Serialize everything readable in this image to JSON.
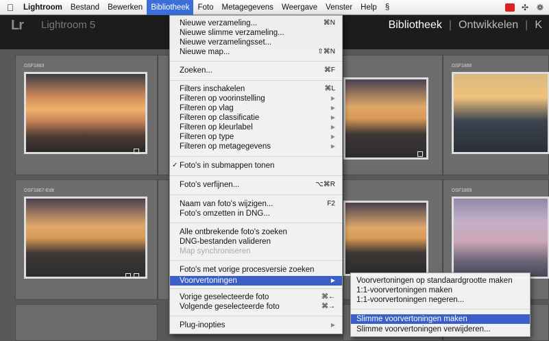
{
  "menubar": {
    "apple": "",
    "app": "Lightroom",
    "items": [
      "Bestand",
      "Bewerken",
      "Bibliotheek",
      "Foto",
      "Metagegevens",
      "Weergave",
      "Venster",
      "Help"
    ],
    "active": "Bibliotheek"
  },
  "header": {
    "logo": "Lr",
    "app_name": "Lightroom 5",
    "modules": [
      "Bibliotheek",
      "Ontwikkelen",
      "K"
    ]
  },
  "grid": {
    "cells": [
      {
        "number": "",
        "filename": "DSF1863"
      },
      {
        "number": "",
        "filename": ""
      },
      {
        "number": "",
        "filename": "DSF1866"
      },
      {
        "number": "",
        "filename": "DSF1867-Edit"
      },
      {
        "number": "",
        "filename": ""
      },
      {
        "number": "",
        "filename": "DSF1869"
      }
    ]
  },
  "menu": {
    "items": [
      {
        "label": "Nieuwe verzameling...",
        "shortcut": "⌘N"
      },
      {
        "label": "Nieuwe slimme verzameling..."
      },
      {
        "label": "Nieuwe verzamelingsset..."
      },
      {
        "label": "Nieuwe map...",
        "shortcut": "⇧⌘N"
      },
      {
        "label": "Zoeken...",
        "shortcut": "⌘F"
      },
      {
        "label": "Filters inschakelen",
        "shortcut": "⌘L"
      },
      {
        "label": "Filteren op voorinstelling",
        "submenu": true
      },
      {
        "label": "Filteren op vlag",
        "submenu": true
      },
      {
        "label": "Filteren op classificatie",
        "submenu": true
      },
      {
        "label": "Filteren op kleurlabel",
        "submenu": true
      },
      {
        "label": "Filteren op type",
        "submenu": true
      },
      {
        "label": "Filteren op metagegevens",
        "submenu": true
      },
      {
        "label": "Foto's in submappen tonen",
        "checked": true
      },
      {
        "label": "Foto's verfijnen...",
        "shortcut": "⌥⌘R"
      },
      {
        "label": "Naam van foto's wijzigen...",
        "shortcut": "F2"
      },
      {
        "label": "Foto's omzetten in DNG..."
      },
      {
        "label": "Alle ontbrekende foto's zoeken"
      },
      {
        "label": "DNG-bestanden valideren"
      },
      {
        "label": "Map synchroniseren",
        "disabled": true
      },
      {
        "label": "Foto's met vorige procesversie zoeken"
      },
      {
        "label": "Voorvertoningen",
        "submenu": true,
        "highlighted": true
      },
      {
        "label": "Vorige geselecteerde foto",
        "shortcut": "⌘←"
      },
      {
        "label": "Volgende geselecteerde foto",
        "shortcut": "⌘→"
      },
      {
        "label": "Plug-inopties",
        "submenu": true
      }
    ]
  },
  "submenu": {
    "items": [
      {
        "label": "Voorvertoningen op standaardgrootte maken"
      },
      {
        "label": "1:1-voorvertoningen maken"
      },
      {
        "label": "1:1-voorvertoningen negeren..."
      },
      {
        "label": "Slimme voorvertoningen maken",
        "highlighted": true
      },
      {
        "label": "Slimme voorvertoningen verwijderen..."
      }
    ]
  },
  "checkmark": "✓",
  "arrow": "▶",
  "colors": {
    "highlight": "#3b5fc8",
    "menubar_active": "#3b6fd7",
    "lr_header": "#1c1c1c"
  }
}
